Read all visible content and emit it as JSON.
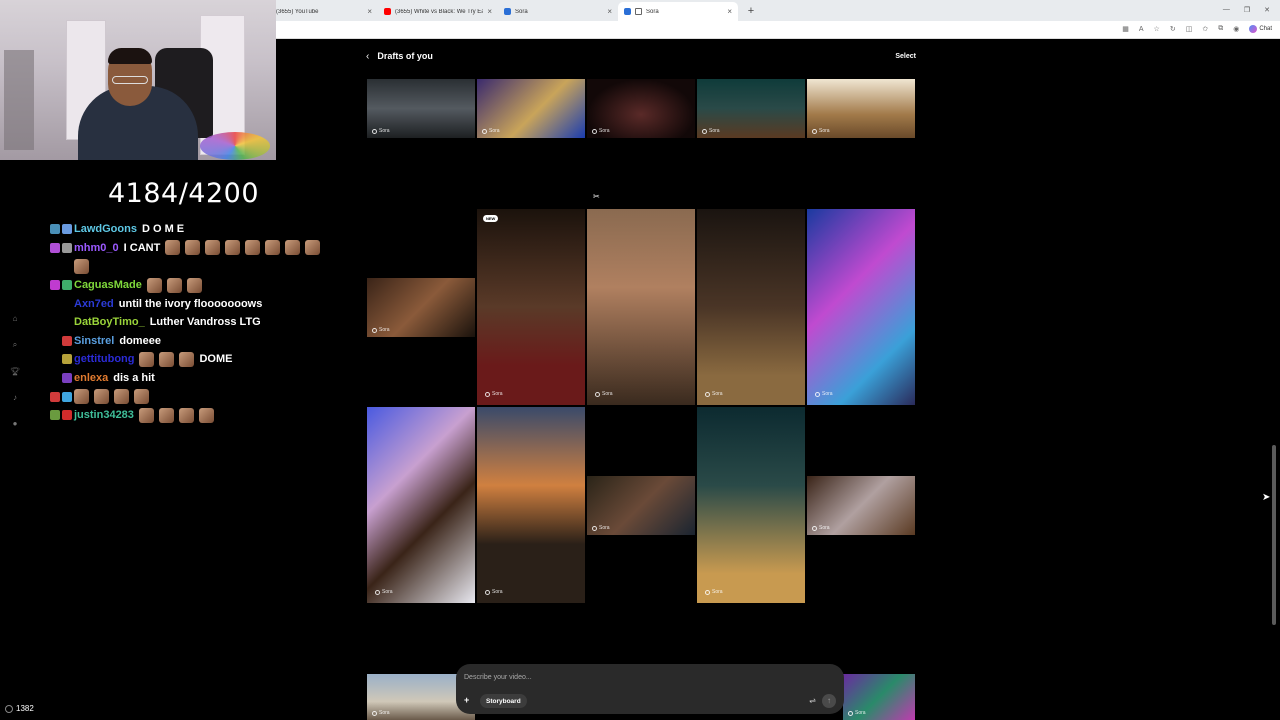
{
  "browser": {
    "tabs": [
      {
        "title": "(3655) YouTube",
        "favicon": "youtube-favicon",
        "active": false
      },
      {
        "title": "(3655) White vs Black: We Try Eac",
        "favicon": "youtube-favicon",
        "active": false
      },
      {
        "title": "Sora",
        "favicon": "sora-favicon",
        "active": false
      },
      {
        "title": "Sora",
        "favicon": "sora-favicon",
        "active": true
      }
    ],
    "new_tab_label": "+",
    "chat_label": "Chat"
  },
  "stream": {
    "counter": "4184/4200",
    "viewer_count": "1382",
    "chat": [
      {
        "user": "LawdGoons",
        "color": "#5ec8e5",
        "text": "D O M E",
        "emotes": 0,
        "badges": [
          "#4a90b8",
          "#6a9be0"
        ]
      },
      {
        "user": "mhm0_0",
        "color": "#9b59ff",
        "text": "I CANT",
        "emotes": 8,
        "badges": [
          "#b04fd6",
          "#999"
        ]
      },
      {
        "user": "",
        "color": "#fff",
        "text": "",
        "emotes": 1,
        "badges": []
      },
      {
        "user": "CaguasMade",
        "color": "#7fd83b",
        "text": "",
        "emotes": 3,
        "badges": [
          "#c03bd0",
          "#3fae6a"
        ]
      },
      {
        "user": "Axn7ed",
        "color": "#2b3bd6",
        "text": "until the ivory flooooooows",
        "emotes": 0,
        "badges": []
      },
      {
        "user": "DatBoyTimo_",
        "color": "#9ad43a",
        "text": "Luther Vandross LTG",
        "emotes": 0,
        "badges": []
      },
      {
        "user": "Sinstrel",
        "color": "#5a9fe0",
        "text": "domeee",
        "emotes": 0,
        "badges": [
          "#d03b3b"
        ]
      },
      {
        "user": "gettitubong",
        "color": "#2b2bd6",
        "text": "DOME",
        "emotes": 3,
        "badges": [
          "#b6a23a"
        ]
      },
      {
        "user": "enlexa",
        "color": "#e07a2f",
        "text": "dis a hit",
        "emotes": 0,
        "badges": [
          "#7a3fc0"
        ]
      },
      {
        "user": "",
        "color": "#fff",
        "text": "",
        "emotes": 4,
        "badges": [
          "#d03b3b",
          "#3fa6e0"
        ]
      },
      {
        "user": "justin34283",
        "color": "#3fbf9a",
        "text": "",
        "emotes": 4,
        "badges": [
          "#6a9b3f",
          "#d02b2b"
        ]
      }
    ]
  },
  "sora": {
    "back_icon": "chevron-left-icon",
    "title": "Drafts of you",
    "select_label": "Select",
    "new_badge": "NEW",
    "watermark": "Sora",
    "composer": {
      "placeholder": "Describe your video...",
      "storyboard_label": "Storyboard",
      "plus_icon": "plus-icon",
      "settings_icon": "sliders-icon",
      "send_icon": "arrow-up-icon"
    }
  }
}
